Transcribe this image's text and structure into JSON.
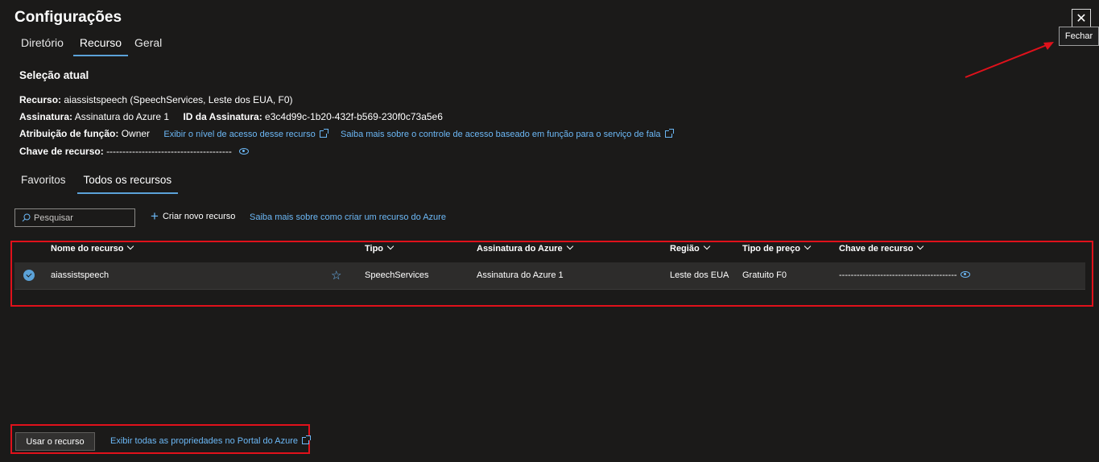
{
  "panel": {
    "title": "Configurações",
    "close_label": "✕",
    "tooltip": "Fechar"
  },
  "tabs": [
    "Diretório",
    "Recurso",
    "Geral"
  ],
  "current": {
    "section_title": "Seleção atual",
    "resource_label": "Recurso:",
    "resource_value": "aiassistspeech (SpeechServices, Leste dos EUA, F0)",
    "subscription_label": "Assinatura:",
    "subscription_value": "Assinatura do Azure 1",
    "subscription_id_label": "ID da Assinatura:",
    "subscription_id_value": "e3c4d99c-1b20-432f-b569-230f0c73a5e6",
    "role_label": "Atribuição de função:",
    "role_value": "Owner",
    "role_link": "Exibir o nível de acesso desse recurso",
    "rbac_link": "Saiba mais sobre o controle de acesso baseado em função para o serviço de fala",
    "key_label": "Chave de recurso:",
    "key_value": "---------------------------------------"
  },
  "subtabs": [
    "Favoritos",
    "Todos os recursos"
  ],
  "toolbar": {
    "search_placeholder": "Pesquisar",
    "create_label": "Criar novo recurso",
    "learn_link": "Saiba mais sobre como criar um recurso do Azure"
  },
  "table": {
    "columns": [
      "Nome do recurso",
      "Tipo",
      "Assinatura do Azure",
      "Região",
      "Tipo de preço",
      "Chave de recurso"
    ],
    "rows": [
      [
        "aiassistspeech",
        "SpeechServices",
        "Assinatura do Azure 1",
        "Leste dos EUA",
        "Gratuito F0",
        "----------------------------------------"
      ]
    ]
  },
  "footer": {
    "use_button": "Usar o recurso",
    "portal_link": "Exibir todas as propriedades no Portal do Azure"
  },
  "colors": {
    "accent": "#5ba2d8",
    "link": "#6cb8f6",
    "highlight": "#e0111b",
    "background": "#1b1a19"
  },
  "icons": [
    "close-icon",
    "external-link-icon",
    "eye-icon",
    "search-icon",
    "plus-icon",
    "chevron-down-icon",
    "checkmark-icon",
    "star-icon"
  ]
}
